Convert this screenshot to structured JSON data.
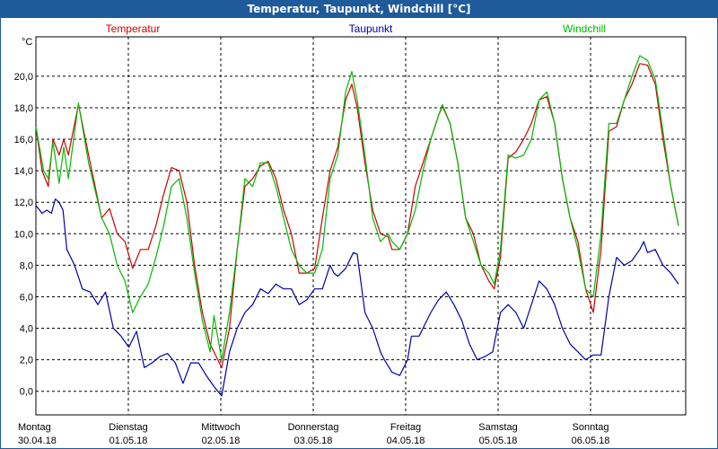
{
  "window": {
    "title": "Temperatur, Taupunkt, Windchill [°C]"
  },
  "colors": {
    "temperature": "#cc0000",
    "dewpoint": "#0000aa",
    "windchill": "#00bb00",
    "grid": "#000000",
    "titlebar": "#1f5a9a"
  },
  "chart_data": {
    "type": "line",
    "title": "Temperatur, Taupunkt, Windchill [°C]",
    "unit": "°C",
    "ylim": [
      -1.5,
      22.5
    ],
    "yticks": [
      0,
      2,
      4,
      6,
      8,
      10,
      12,
      14,
      16,
      18,
      20
    ],
    "ytick_labels": [
      "0,0",
      "2,0",
      "4,0",
      "6,0",
      "8,0",
      "10,0",
      "12,0",
      "14,0",
      "16,0",
      "18,0",
      "20,0"
    ],
    "grid": true,
    "legend_position": "top",
    "x_range_days": [
      0,
      7
    ],
    "days": [
      {
        "weekday": "Montag",
        "date": "30.04.18"
      },
      {
        "weekday": "Dienstag",
        "date": "01.05.18"
      },
      {
        "weekday": "Mittwoch",
        "date": "02.05.18"
      },
      {
        "weekday": "Donnerstag",
        "date": "03.05.18"
      },
      {
        "weekday": "Freitag",
        "date": "04.05.18"
      },
      {
        "weekday": "Samstag",
        "date": "05.05.18"
      },
      {
        "weekday": "Sonntag",
        "date": "06.05.18"
      }
    ],
    "series": [
      {
        "name": "Temperatur",
        "color": "#cc0000",
        "points": [
          [
            0,
            16.8
          ],
          [
            0.08,
            14.0
          ],
          [
            0.16,
            13.0
          ],
          [
            0.22,
            16.0
          ],
          [
            0.3,
            15.0
          ],
          [
            0.36,
            16.0
          ],
          [
            0.42,
            15.0
          ],
          [
            0.55,
            18.2
          ],
          [
            0.68,
            15.0
          ],
          [
            0.85,
            11.0
          ],
          [
            0.95,
            11.6
          ],
          [
            1.05,
            10.0
          ],
          [
            1.15,
            9.5
          ],
          [
            1.25,
            7.8
          ],
          [
            1.35,
            9.0
          ],
          [
            1.45,
            9.0
          ],
          [
            1.55,
            10.5
          ],
          [
            1.65,
            12.5
          ],
          [
            1.75,
            14.2
          ],
          [
            1.85,
            14.0
          ],
          [
            1.95,
            12.0
          ],
          [
            2.05,
            8.0
          ],
          [
            2.15,
            5.0
          ],
          [
            2.25,
            3.0
          ],
          [
            2.4,
            1.5
          ],
          [
            2.5,
            4.0
          ],
          [
            2.6,
            9.0
          ],
          [
            2.7,
            13.0
          ],
          [
            2.8,
            13.5
          ],
          [
            2.9,
            14.3
          ],
          [
            3.0,
            14.6
          ],
          [
            3.1,
            13.5
          ],
          [
            3.2,
            11.5
          ],
          [
            3.3,
            10.0
          ],
          [
            3.4,
            7.5
          ],
          [
            3.5,
            7.5
          ],
          [
            3.6,
            7.8
          ],
          [
            3.7,
            11.0
          ],
          [
            3.8,
            14.0
          ],
          [
            3.9,
            15.5
          ],
          [
            4.0,
            18.5
          ],
          [
            4.08,
            19.5
          ],
          [
            4.15,
            18.0
          ],
          [
            4.25,
            14.5
          ],
          [
            4.35,
            11.5
          ],
          [
            4.45,
            10.0
          ],
          [
            4.55,
            9.8
          ],
          [
            4.6,
            9.0
          ],
          [
            4.7,
            9.0
          ],
          [
            4.8,
            10.0
          ],
          [
            4.9,
            13.0
          ],
          [
            5.0,
            14.5
          ],
          [
            5.1,
            16.0
          ],
          [
            5.2,
            17.5
          ],
          [
            5.25,
            18.1
          ],
          [
            5.35,
            17.0
          ],
          [
            5.45,
            14.5
          ],
          [
            5.55,
            11.0
          ],
          [
            5.65,
            10.0
          ],
          [
            5.75,
            8.0
          ],
          [
            5.85,
            7.0
          ],
          [
            5.92,
            6.5
          ],
          [
            6.0,
            8.5
          ],
          [
            6.1,
            14.8
          ],
          [
            6.2,
            15.2
          ],
          [
            6.3,
            16.0
          ],
          [
            6.4,
            17.0
          ],
          [
            6.5,
            18.5
          ],
          [
            6.6,
            18.7
          ],
          [
            6.7,
            17.0
          ],
          [
            6.8,
            13.5
          ],
          [
            6.9,
            11.0
          ],
          [
            7.0,
            9.5
          ],
          [
            7.1,
            6.5
          ],
          [
            7.2,
            5.0
          ],
          [
            7.3,
            9.0
          ],
          [
            7.4,
            16.5
          ],
          [
            7.5,
            16.8
          ],
          [
            7.6,
            18.5
          ],
          [
            7.7,
            19.5
          ],
          [
            7.8,
            20.8
          ],
          [
            7.9,
            20.7
          ],
          [
            8.0,
            19.5
          ],
          [
            8.1,
            16.0
          ],
          [
            8.2,
            13.0
          ],
          [
            8.3,
            10.5
          ]
        ]
      },
      {
        "name": "Taupunkt",
        "color": "#0000aa",
        "points": [
          [
            0,
            11.8
          ],
          [
            0.08,
            11.3
          ],
          [
            0.14,
            11.5
          ],
          [
            0.2,
            11.3
          ],
          [
            0.25,
            12.2
          ],
          [
            0.3,
            12.0
          ],
          [
            0.35,
            11.5
          ],
          [
            0.4,
            9.0
          ],
          [
            0.5,
            8.0
          ],
          [
            0.6,
            6.5
          ],
          [
            0.7,
            6.3
          ],
          [
            0.8,
            5.5
          ],
          [
            0.9,
            6.3
          ],
          [
            1.0,
            4.0
          ],
          [
            1.1,
            3.5
          ],
          [
            1.2,
            2.8
          ],
          [
            1.3,
            3.8
          ],
          [
            1.4,
            1.5
          ],
          [
            1.5,
            1.8
          ],
          [
            1.6,
            2.2
          ],
          [
            1.7,
            2.4
          ],
          [
            1.8,
            1.8
          ],
          [
            1.9,
            0.5
          ],
          [
            2.0,
            1.8
          ],
          [
            2.1,
            1.8
          ],
          [
            2.2,
            1.0
          ],
          [
            2.3,
            0.3
          ],
          [
            2.4,
            -0.3
          ],
          [
            2.5,
            2.5
          ],
          [
            2.6,
            4.0
          ],
          [
            2.7,
            5.0
          ],
          [
            2.8,
            5.5
          ],
          [
            2.9,
            6.5
          ],
          [
            3.0,
            6.2
          ],
          [
            3.1,
            6.8
          ],
          [
            3.2,
            6.5
          ],
          [
            3.3,
            6.5
          ],
          [
            3.4,
            5.5
          ],
          [
            3.5,
            5.8
          ],
          [
            3.6,
            6.5
          ],
          [
            3.7,
            6.5
          ],
          [
            3.8,
            8.0
          ],
          [
            3.85,
            7.5
          ],
          [
            3.9,
            7.3
          ],
          [
            4.0,
            7.8
          ],
          [
            4.1,
            8.8
          ],
          [
            4.15,
            8.7
          ],
          [
            4.25,
            5.0
          ],
          [
            4.35,
            4.0
          ],
          [
            4.45,
            2.5
          ],
          [
            4.5,
            2.0
          ],
          [
            4.6,
            1.2
          ],
          [
            4.7,
            1.0
          ],
          [
            4.8,
            2.0
          ],
          [
            4.85,
            3.5
          ],
          [
            4.95,
            3.5
          ],
          [
            5.0,
            4.0
          ],
          [
            5.1,
            5.0
          ],
          [
            5.2,
            5.8
          ],
          [
            5.3,
            6.3
          ],
          [
            5.4,
            5.5
          ],
          [
            5.5,
            4.5
          ],
          [
            5.6,
            3.0
          ],
          [
            5.7,
            2.0
          ],
          [
            5.8,
            2.2
          ],
          [
            5.9,
            2.5
          ],
          [
            6.0,
            5.0
          ],
          [
            6.1,
            5.5
          ],
          [
            6.2,
            5.0
          ],
          [
            6.3,
            4.0
          ],
          [
            6.4,
            5.5
          ],
          [
            6.5,
            7.0
          ],
          [
            6.6,
            6.5
          ],
          [
            6.7,
            5.5
          ],
          [
            6.8,
            4.0
          ],
          [
            6.9,
            3.0
          ],
          [
            7.0,
            2.5
          ],
          [
            7.1,
            2.0
          ],
          [
            7.2,
            2.3
          ],
          [
            7.3,
            2.3
          ],
          [
            7.4,
            6.0
          ],
          [
            7.5,
            8.5
          ],
          [
            7.6,
            8.0
          ],
          [
            7.7,
            8.3
          ],
          [
            7.8,
            9.0
          ],
          [
            7.85,
            9.5
          ],
          [
            7.9,
            8.8
          ],
          [
            8.0,
            9.0
          ],
          [
            8.1,
            8.0
          ],
          [
            8.2,
            7.5
          ],
          [
            8.3,
            6.8
          ]
        ]
      },
      {
        "name": "Windchill",
        "color": "#00bb00",
        "points": [
          [
            0,
            16.8
          ],
          [
            0.1,
            14.0
          ],
          [
            0.16,
            13.5
          ],
          [
            0.22,
            15.8
          ],
          [
            0.3,
            13.2
          ],
          [
            0.36,
            15.5
          ],
          [
            0.42,
            13.5
          ],
          [
            0.55,
            18.3
          ],
          [
            0.68,
            14.5
          ],
          [
            0.85,
            11.0
          ],
          [
            0.95,
            10.0
          ],
          [
            1.05,
            8.0
          ],
          [
            1.15,
            7.0
          ],
          [
            1.25,
            5.0
          ],
          [
            1.35,
            6.0
          ],
          [
            1.45,
            6.8
          ],
          [
            1.55,
            8.5
          ],
          [
            1.65,
            10.5
          ],
          [
            1.75,
            13.0
          ],
          [
            1.85,
            13.5
          ],
          [
            1.95,
            11.0
          ],
          [
            2.05,
            7.5
          ],
          [
            2.15,
            4.5
          ],
          [
            2.25,
            2.5
          ],
          [
            2.3,
            4.8
          ],
          [
            2.4,
            2.0
          ],
          [
            2.5,
            5.0
          ],
          [
            2.6,
            9.0
          ],
          [
            2.7,
            13.5
          ],
          [
            2.8,
            13.0
          ],
          [
            2.9,
            14.5
          ],
          [
            3.0,
            14.5
          ],
          [
            3.1,
            13.0
          ],
          [
            3.2,
            11.0
          ],
          [
            3.3,
            9.0
          ],
          [
            3.4,
            8.0
          ],
          [
            3.5,
            7.5
          ],
          [
            3.6,
            7.5
          ],
          [
            3.7,
            9.0
          ],
          [
            3.8,
            13.5
          ],
          [
            3.9,
            15.0
          ],
          [
            4.0,
            19.0
          ],
          [
            4.08,
            20.3
          ],
          [
            4.15,
            18.5
          ],
          [
            4.25,
            15.0
          ],
          [
            4.35,
            11.0
          ],
          [
            4.45,
            9.5
          ],
          [
            4.55,
            10.0
          ],
          [
            4.6,
            9.5
          ],
          [
            4.7,
            9.0
          ],
          [
            4.8,
            10.0
          ],
          [
            4.9,
            11.5
          ],
          [
            5.0,
            14.0
          ],
          [
            5.1,
            16.0
          ],
          [
            5.2,
            17.5
          ],
          [
            5.25,
            18.2
          ],
          [
            5.35,
            17.0
          ],
          [
            5.45,
            14.5
          ],
          [
            5.55,
            11.0
          ],
          [
            5.65,
            9.5
          ],
          [
            5.75,
            8.0
          ],
          [
            5.85,
            7.5
          ],
          [
            5.92,
            6.8
          ],
          [
            6.0,
            9.0
          ],
          [
            6.1,
            15.0
          ],
          [
            6.2,
            14.8
          ],
          [
            6.3,
            15.0
          ],
          [
            6.4,
            16.0
          ],
          [
            6.5,
            18.5
          ],
          [
            6.6,
            19.0
          ],
          [
            6.7,
            17.0
          ],
          [
            6.8,
            13.5
          ],
          [
            6.9,
            11.0
          ],
          [
            7.0,
            9.0
          ],
          [
            7.1,
            6.5
          ],
          [
            7.2,
            6.0
          ],
          [
            7.3,
            10.0
          ],
          [
            7.4,
            17.0
          ],
          [
            7.5,
            17.0
          ],
          [
            7.6,
            18.5
          ],
          [
            7.7,
            20.0
          ],
          [
            7.8,
            21.3
          ],
          [
            7.9,
            21.0
          ],
          [
            8.0,
            19.8
          ],
          [
            8.1,
            16.5
          ],
          [
            8.2,
            13.0
          ],
          [
            8.3,
            10.5
          ]
        ]
      }
    ]
  }
}
